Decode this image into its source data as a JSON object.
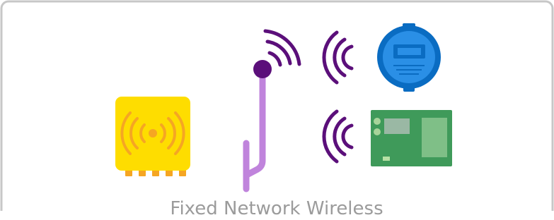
{
  "caption": "Fixed Network Wireless",
  "colors": {
    "frame": "#c7c7c7",
    "gateway_body": "#fedd00",
    "gateway_waves": "#f5a623",
    "gateway_ports": "#f5a623",
    "antenna": "#c084dc",
    "waves": "#5b0f7a",
    "meter_outer": "#0a6cc2",
    "meter_inner": "#2a8fe6",
    "board": "#3f9a5a",
    "caption_text": "#9b9b9b"
  },
  "icons": {
    "gateway": "gateway-icon",
    "antenna": "antenna-tower-icon",
    "meter": "water-meter-icon",
    "board": "circuit-board-icon"
  }
}
